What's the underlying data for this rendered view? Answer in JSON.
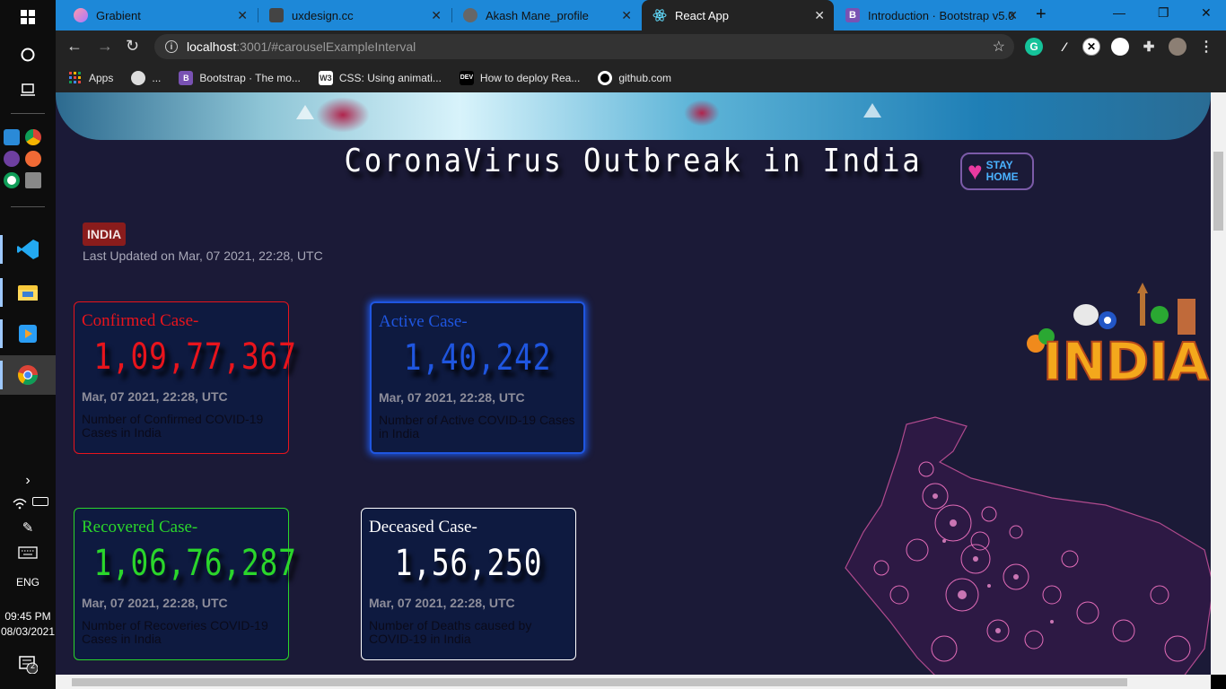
{
  "taskbar": {
    "language": "ENG",
    "time": "09:45 PM",
    "date": "08/03/2021",
    "notification_count": "2"
  },
  "browser": {
    "tabs": [
      {
        "label": "Grabient",
        "icon": "grabient-icon",
        "color": "#e56bb0"
      },
      {
        "label": "uxdesign.cc",
        "icon": "uxdesign-icon",
        "color": "#333333"
      },
      {
        "label": "Akash Mane_profile",
        "icon": "globe-icon",
        "color": "#555555"
      },
      {
        "label": "React App",
        "icon": "react-icon",
        "color": "#61dafb"
      },
      {
        "label": "Introduction · Bootstrap v5.0",
        "icon": "bootstrap-icon",
        "color": "#7952b3"
      }
    ],
    "active_tab_index": 3,
    "url_host": "localhost",
    "url_path": ":3001/#carouselExampleInterval",
    "bookmarks": [
      {
        "label": "Apps",
        "icon": "apps-grid-icon"
      },
      {
        "label": "...",
        "icon": "globe-icon"
      },
      {
        "label": "Bootstrap · The mo...",
        "icon": "bootstrap-icon"
      },
      {
        "label": "CSS: Using animati...",
        "icon": "w3-icon"
      },
      {
        "label": "How to deploy Rea...",
        "icon": "dev-icon"
      },
      {
        "label": "github.com",
        "icon": "github-icon"
      }
    ]
  },
  "page": {
    "title": "CoronaVirus Outbreak in India",
    "stay_home_line1": "STAY",
    "stay_home_line2": "HOME",
    "country_badge": "INDIA",
    "last_updated": "Last Updated on Mar, 07 2021, 22:28, UTC",
    "cards": [
      {
        "label": "Confirmed Case-",
        "value": "1,09,77,367",
        "date": "Mar, 07 2021, 22:28, UTC",
        "desc": "Number of Confirmed COVID-19 Cases in India",
        "color": "#e8141c"
      },
      {
        "label": "Active Case-",
        "value": "1,40,242",
        "date": "Mar, 07 2021, 22:28, UTC",
        "desc": "Number of Active COVID-19 Cases in India",
        "color": "#1f56e0"
      },
      {
        "label": "Recovered Case-",
        "value": "1,06,76,287",
        "date": "Mar, 07 2021, 22:28, UTC",
        "desc": "Number of Recoveries COVID-19 Cases in India",
        "color": "#2bd62b"
      },
      {
        "label": "Deceased Case-",
        "value": "1,56,250",
        "date": "Mar, 07 2021, 22:28, UTC",
        "desc": "Number of Deaths caused by COVID-19 in India",
        "color": "#ffffff"
      }
    ],
    "india_art_text": "INDIA"
  }
}
